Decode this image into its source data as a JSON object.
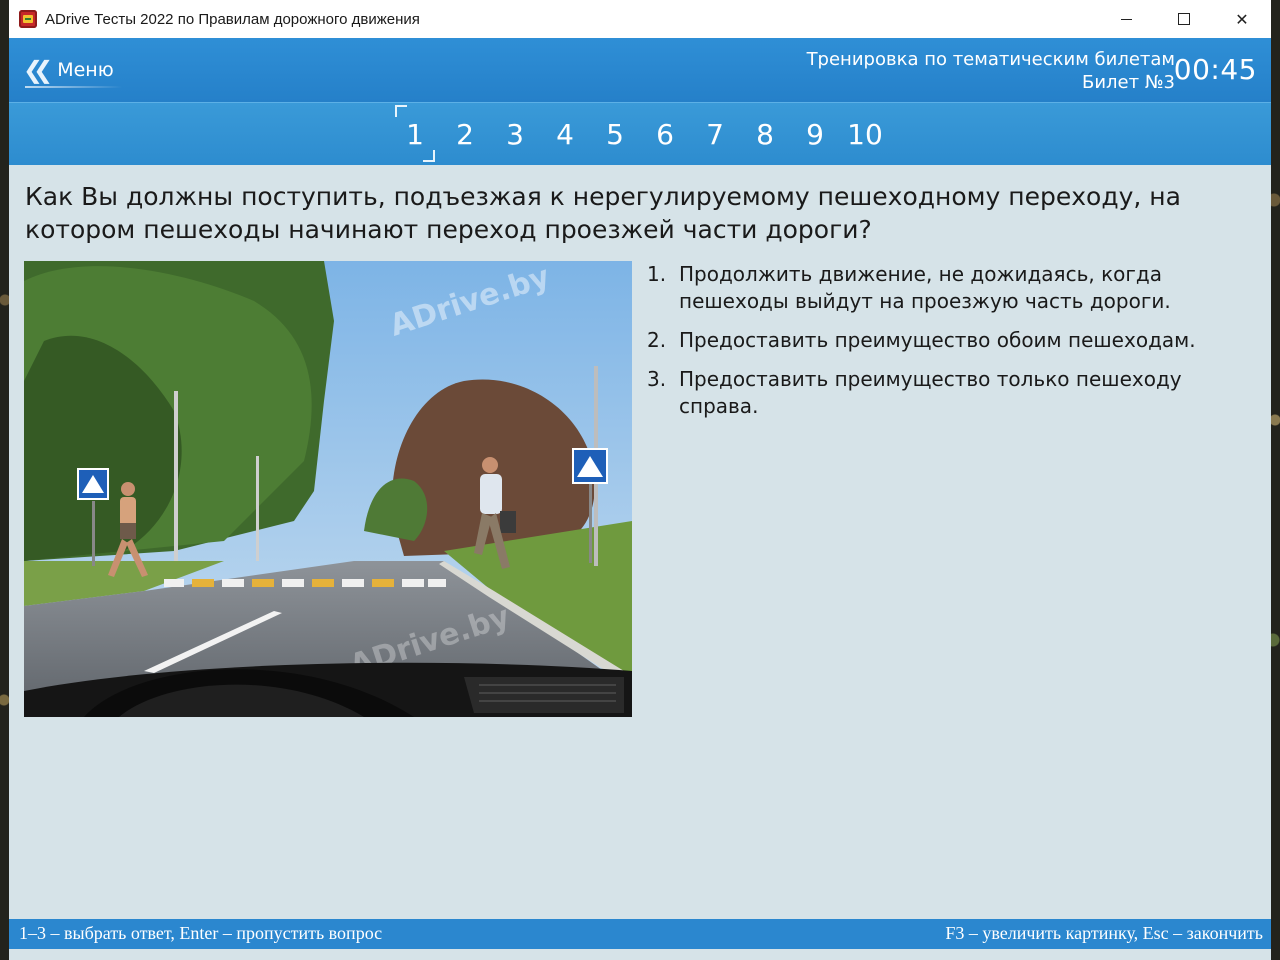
{
  "window": {
    "title": "ADrive Тесты 2022 по Правилам дорожного движения",
    "controls": {
      "minimize_icon": "minimize-icon",
      "maximize_icon": "maximize-icon",
      "close_icon": "close-icon",
      "close_glyph": "✕"
    }
  },
  "header": {
    "menu_label": "Меню",
    "menu_icon": "double-chevron-left-icon",
    "menu_glyph": "❮❮",
    "mode": "Тренировка по тематическим билетам",
    "ticket": "Билет №3",
    "timer": "00:45"
  },
  "tickets": {
    "items": [
      "1",
      "2",
      "3",
      "4",
      "5",
      "6",
      "7",
      "8",
      "9",
      "10"
    ],
    "active": "1"
  },
  "question": {
    "text": "Как Вы должны поступить, подъезжая к нерегулируемому пешеходному переходу, на котором пешеходы начинают переход проезжей части дороги?",
    "image_watermark": "ADrive.by"
  },
  "answers": [
    {
      "num": "1.",
      "text": "Продолжить движение, не дожидаясь, когда пешеходы выйдут на проезжую часть дороги."
    },
    {
      "num": "2.",
      "text": "Предоставить преимущество обоим пешеходам."
    },
    {
      "num": "3.",
      "text": "Предоставить преимущество только пешеходу справа."
    }
  ],
  "footer": {
    "left_hint": "1–3 – выбрать ответ, Enter – пропустить вопрос",
    "right_hint": "F3 – увеличить картинку, Esc – закончить"
  },
  "colors": {
    "header_blue": "#2f8fd6",
    "ticket_bar_blue": "#3a9ad8",
    "content_bg": "#d6e3e8",
    "footer_blue": "#2b87cf"
  }
}
